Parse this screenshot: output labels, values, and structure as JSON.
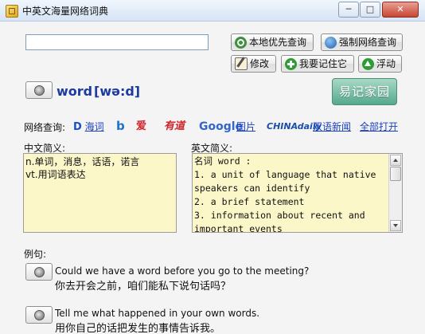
{
  "window": {
    "title": "中英文海量网络词典",
    "minimize_glyph": "─",
    "maximize_glyph": "□",
    "close_glyph": "✕"
  },
  "search": {
    "value": "",
    "placeholder": ""
  },
  "toolbar": {
    "local_lookup": {
      "label": "本地优先查询",
      "icon": "search-icon"
    },
    "web_lookup": {
      "label": "强制网络查询",
      "icon": "globe-icon"
    },
    "edit": {
      "label": "修改",
      "icon": "edit-icon"
    },
    "remember": {
      "label": "我要记住它",
      "icon": "plus-icon"
    },
    "float": {
      "label": "浮动",
      "icon": "up-arrow-icon"
    }
  },
  "entry": {
    "word": "word",
    "phonetic": "[wə:d]"
  },
  "logo_text": "易记家园",
  "web_query": {
    "label": "网络查询:",
    "links": [
      {
        "name": "haici",
        "text": "海词",
        "badge": "D"
      },
      {
        "name": "bing",
        "text": "b"
      },
      {
        "name": "iciba",
        "text": "爱"
      },
      {
        "name": "youdao",
        "text": "有道"
      },
      {
        "name": "google",
        "text": "Google"
      },
      {
        "name": "google-images",
        "text": "图片"
      },
      {
        "name": "chinadaily",
        "text": "CHINAdaily"
      },
      {
        "name": "bilingual-news",
        "text": "双语新闻"
      },
      {
        "name": "open-all",
        "text": "全部打开"
      }
    ]
  },
  "chinese_def": {
    "label": "中文简义:",
    "lines": "n.单词，消息，话语，诺言\nvt.用词语表达"
  },
  "english_def": {
    "label": "英文简义:",
    "lines": "名词 word :\n1. a unit of language that native\nspeakers can identify\n2. a brief statement\n3. information about recent and\nimportant events"
  },
  "examples": {
    "label": "例句:",
    "items": [
      {
        "en": "Could we have a word before you go to the meeting?",
        "zh": "你去开会之前，咱们能私下说句话吗？"
      },
      {
        "en": "Tell me what happened in your own words.",
        "zh": "用你自己的话把发生的事情告诉我。"
      }
    ]
  },
  "colors": {
    "accent": "#1c3aa0",
    "definition_bg": "#fbf7c9",
    "link": "#1a3fc0"
  }
}
